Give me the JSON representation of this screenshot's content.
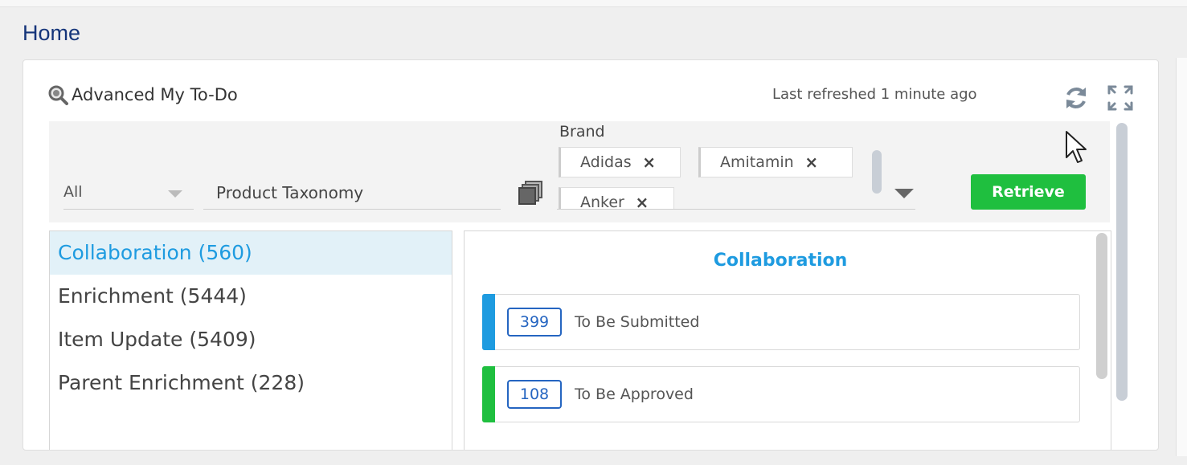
{
  "page": {
    "title": "Home"
  },
  "widget": {
    "title": "Advanced My To-Do",
    "last_refreshed": "Last refreshed 1 minute ago",
    "icons": {
      "title_icon": "search-icon",
      "refresh": "refresh-icon",
      "expand": "expand-icon"
    }
  },
  "filters": {
    "scope_value": "All",
    "taxonomy_placeholder": "Product Taxonomy",
    "brand_label": "Brand",
    "brand_chips": [
      "Adidas",
      "Amitamin",
      "Anker"
    ],
    "chip_remove": "×",
    "retrieve_label": "Retrieve",
    "colors": {
      "retrieve": "#1fbf3f"
    }
  },
  "categories": [
    {
      "label": "Collaboration (560)",
      "active": true
    },
    {
      "label": "Enrichment (5444)",
      "active": false
    },
    {
      "label": "Item Update (5409)",
      "active": false
    },
    {
      "label": "Parent Enrichment (228)",
      "active": false
    }
  ],
  "detail": {
    "title": "Collaboration",
    "tasks": [
      {
        "count": "399",
        "label": "To Be Submitted",
        "color": "#1e9be0"
      },
      {
        "count": "108",
        "label": "To Be Approved",
        "color": "#1fbf3f"
      }
    ]
  }
}
